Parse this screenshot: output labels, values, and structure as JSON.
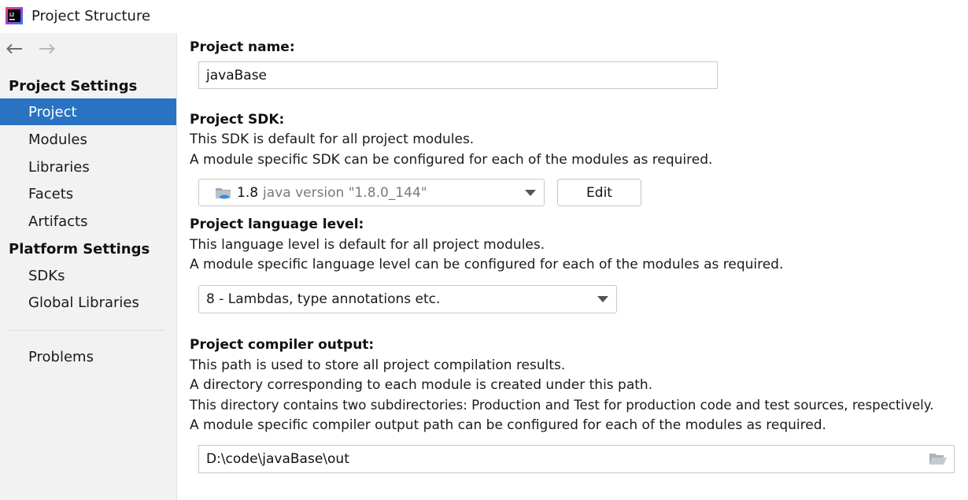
{
  "window": {
    "title": "Project Structure",
    "logo_icon": "intellij-idea-logo-icon"
  },
  "sidebar": {
    "back_icon": "arrow-left-icon",
    "forward_icon": "arrow-right-icon",
    "project_settings_header": "Project Settings",
    "project_settings_items": [
      {
        "label": "Project",
        "selected": true
      },
      {
        "label": "Modules"
      },
      {
        "label": "Libraries"
      },
      {
        "label": "Facets"
      },
      {
        "label": "Artifacts"
      }
    ],
    "platform_settings_header": "Platform Settings",
    "platform_settings_items": [
      {
        "label": "SDKs"
      },
      {
        "label": "Global Libraries"
      }
    ],
    "problems_label": "Problems"
  },
  "main": {
    "project_name": {
      "label": "Project name:",
      "value": "javaBase"
    },
    "project_sdk": {
      "label": "Project SDK:",
      "desc1": "This SDK is default for all project modules.",
      "desc2": "A module specific SDK can be configured for each of the modules as required.",
      "selected_version": "1.8",
      "selected_detail": "java version \"1.8.0_144\"",
      "edit_label": "Edit",
      "sdk_icon": "jdk-folder-icon"
    },
    "language_level": {
      "label": "Project language level:",
      "desc1": "This language level is default for all project modules.",
      "desc2": "A module specific language level can be configured for each of the modules as required.",
      "selected": "8 - Lambdas, type annotations etc."
    },
    "compiler_output": {
      "label": "Project compiler output:",
      "desc1": "This path is used to store all project compilation results.",
      "desc2": "A directory corresponding to each module is created under this path.",
      "desc3": "This directory contains two subdirectories: Production and Test for production code and test sources, respectively.",
      "desc4": "A module specific compiler output path can be configured for each of the modules as required.",
      "path": "D:\\code\\javaBase\\out",
      "browse_icon": "folder-open-icon"
    }
  },
  "colors": {
    "selection": "#2a73c2",
    "sidebar_bg": "#f2f2f2"
  }
}
